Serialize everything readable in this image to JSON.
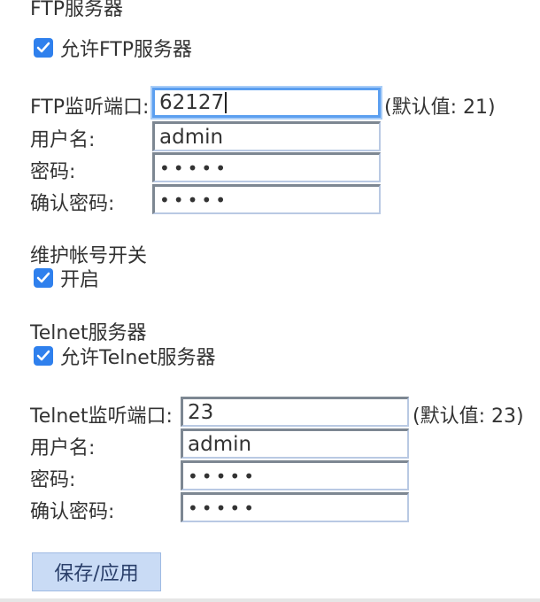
{
  "ftp": {
    "cut_title": "FTP服务器",
    "enable_label": "允许FTP服务器",
    "enable_checked": true,
    "port_label": "FTP监听端口:",
    "port_value": "62127",
    "port_hint": "(默认值: 21)",
    "user_label": "用户名:",
    "user_value": "admin",
    "password_label": "密码:",
    "password_value": "•••••",
    "confirm_label": "确认密码:",
    "confirm_value": "•••••"
  },
  "maintenance": {
    "title": "维护帐号开关",
    "enable_label": "开启",
    "enable_checked": true
  },
  "telnet": {
    "title": "Telnet服务器",
    "enable_label": "允许Telnet服务器",
    "enable_checked": true,
    "port_label": "Telnet监听端口:",
    "port_value": "23",
    "port_hint": "(默认值: 23)",
    "user_label": "用户名:",
    "user_value": "admin",
    "password_label": "密码:",
    "password_value": "•••••",
    "confirm_label": "确认密码:",
    "confirm_value": "•••••"
  },
  "actions": {
    "save_label": "保存/应用"
  },
  "colors": {
    "checkbox": "#2f80ed",
    "focus": "#5b9ff0",
    "button_bg": "#c9dbf5"
  }
}
